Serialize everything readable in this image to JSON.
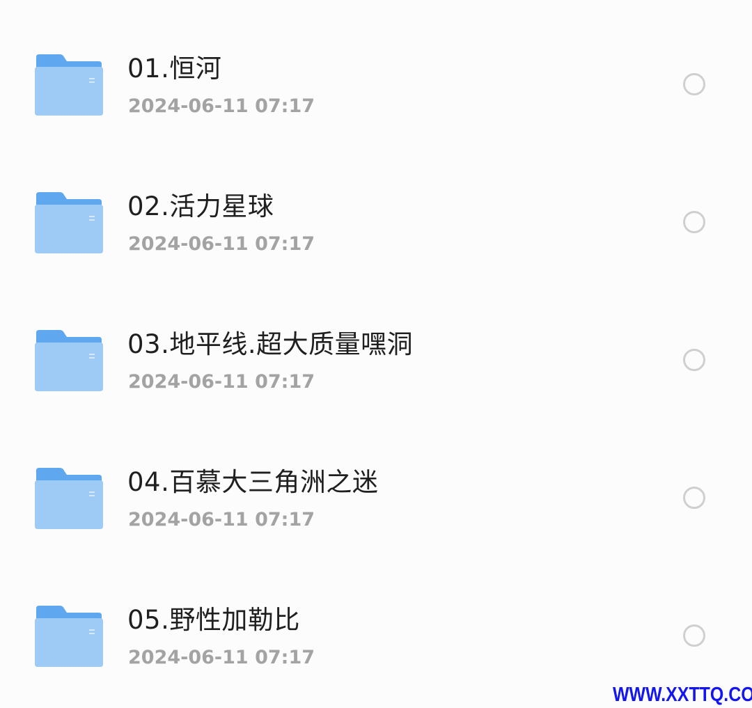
{
  "files": [
    {
      "name": "01.恒河",
      "date": "2024-06-11 07:17",
      "icon": "folder-icon",
      "selected": false
    },
    {
      "name": "02.活力星球",
      "date": "2024-06-11 07:17",
      "icon": "folder-icon",
      "selected": false
    },
    {
      "name": "03.地平线.超大质量嘿洞",
      "date": "2024-06-11 07:17",
      "icon": "folder-icon",
      "selected": false
    },
    {
      "name": "04.百慕大三角洲之迷",
      "date": "2024-06-11 07:17",
      "icon": "folder-icon",
      "selected": false
    },
    {
      "name": "05.野性加勒比",
      "date": "2024-06-11 07:17",
      "icon": "folder-icon",
      "selected": false
    }
  ],
  "watermark": "WWW.XXTTQ.COM",
  "colors": {
    "background": "#fcfcfd",
    "name_text": "#1f1f1f",
    "date_text": "#a3a3a3",
    "folder_back": "#5fa8ef",
    "folder_front": "#9ecbf5",
    "radio_border": "#cfcfcf",
    "watermark": "#1416f2"
  }
}
